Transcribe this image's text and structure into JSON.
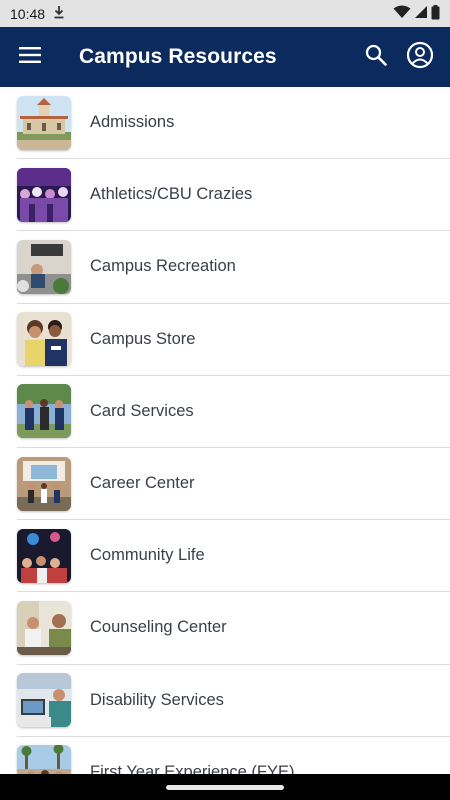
{
  "status_bar": {
    "time": "10:48",
    "icons": [
      "download-icon",
      "wifi-icon",
      "cellular-signal-icon",
      "battery-icon"
    ]
  },
  "app_bar": {
    "title": "Campus Resources",
    "background_color": "#0b2a5e",
    "icons": [
      "hamburger-menu-icon",
      "search-icon",
      "account-circle-icon"
    ]
  },
  "resources": [
    {
      "label": "Admissions",
      "thumb": "photo-admissions"
    },
    {
      "label": "Athletics/CBU Crazies",
      "thumb": "photo-athletics"
    },
    {
      "label": "Campus Recreation",
      "thumb": "photo-recreation"
    },
    {
      "label": "Campus Store",
      "thumb": "photo-store"
    },
    {
      "label": "Card Services",
      "thumb": "photo-card-services"
    },
    {
      "label": "Career Center",
      "thumb": "photo-career"
    },
    {
      "label": "Community Life",
      "thumb": "photo-community"
    },
    {
      "label": "Counseling Center",
      "thumb": "photo-counseling"
    },
    {
      "label": "Disability Services",
      "thumb": "photo-disability"
    },
    {
      "label": "First Year Experience (FYE)",
      "thumb": "photo-fye"
    }
  ]
}
